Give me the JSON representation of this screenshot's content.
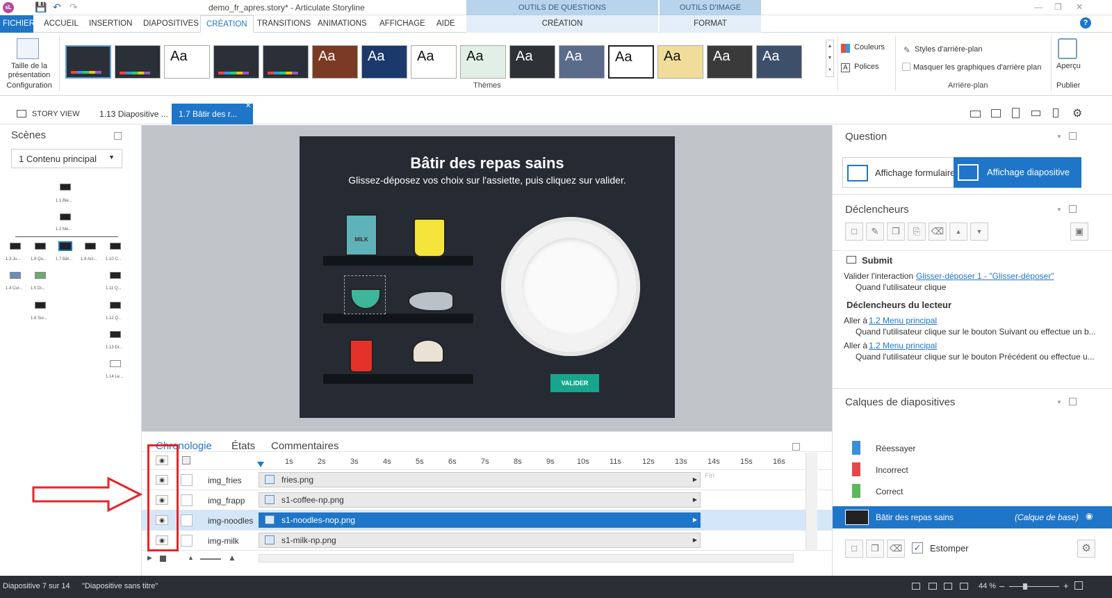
{
  "app": {
    "title": "demo_fr_apres.story* - Articulate Storyline",
    "logo": "sL"
  },
  "context_headers": [
    "OUTILS DE QUESTIONS",
    "OUTILS D'IMAGE"
  ],
  "ribbon_tabs": [
    "FICHIER",
    "ACCUEIL",
    "INSERTION",
    "DIAPOSITIVES",
    "CRÉATION",
    "TRANSITIONS",
    "ANIMATIONS",
    "AFFICHAGE",
    "AIDE"
  ],
  "context_tabs": [
    "CRÉATION",
    "FORMAT"
  ],
  "ribbon": {
    "config_label": "Taille de la présentation",
    "config_group": "Configuration",
    "theme_text": "Aa",
    "themes_group": "Thèmes",
    "colors": "Couleurs",
    "fonts": "Polices",
    "bg_styles": "Styles d'arrière-plan",
    "hide_bg": "Masquer les graphiques d'arrière plan",
    "bg_group": "Arrière-plan",
    "preview": "Aperçu",
    "publish": "Publier"
  },
  "doc_tabs": {
    "story": "STORY VIEW",
    "tab1": "1.13 Diapositive ...",
    "tab2": "1.7 Bâtir des r..."
  },
  "scenes": {
    "title": "Scènes",
    "dropdown": "1 Contenu principal",
    "thumbs": [
      "1.1 Bie...",
      "1.2 Me...",
      "1.3 Ju...",
      "1.8 Qu...",
      "1.7 Bât...",
      "1.9 Act...",
      "1.10 C...",
      "1.4 Cur...",
      "1.5 Di...",
      "1.11 Q...",
      "1.6 Sui...",
      "1.12 Q...",
      "1.13 Di...",
      "1.14 Le..."
    ]
  },
  "slide": {
    "title": "Bâtir des repas sains",
    "subtitle": "Glissez-déposez vos choix sur l'assiette, puis cliquez sur valider.",
    "button": "VALIDER",
    "milk": "MILK"
  },
  "timeline": {
    "tabs": [
      "Chronologie",
      "États",
      "Commentaires"
    ],
    "ticks": [
      "1s",
      "2s",
      "3s",
      "4s",
      "5s",
      "6s",
      "7s",
      "8s",
      "9s",
      "10s",
      "11s",
      "12s",
      "13s",
      "14s",
      "15s",
      "16s"
    ],
    "end_label": "Fin",
    "rows": [
      {
        "name": "img_fries",
        "file": "fries.png"
      },
      {
        "name": "img_frapp",
        "file": "s1-coffee-np.png"
      },
      {
        "name": "img-noodles",
        "file": "s1-noodles-nop.png"
      },
      {
        "name": "img-milk",
        "file": "s1-milk-np.png"
      }
    ]
  },
  "right": {
    "question_title": "Question",
    "form_view": "Affichage formulaire",
    "slide_view": "Affichage diapositive",
    "triggers_title": "Déclencheurs",
    "submit": "Submit",
    "validate": "Valider l'interaction",
    "validate_link": "Glisser-déposer 1 - \"Glisser-déposer\"",
    "when_click": "Quand l'utilisateur clique",
    "player_triggers": "Déclencheurs du lecteur",
    "goto": "Aller à",
    "goto_link": "1.2 Menu principal",
    "next_cond": "Quand l'utilisateur clique sur le bouton Suivant ou effectue un b...",
    "prev_cond": "Quand l'utilisateur clique sur le bouton Précédent ou effectue u...",
    "layers_title": "Calques de diapositives",
    "layers": [
      {
        "name": "Réessayer",
        "color": "#3a8fd9"
      },
      {
        "name": "Incorrect",
        "color": "#e8454f"
      },
      {
        "name": "Correct",
        "color": "#5cb85c"
      }
    ],
    "base_layer": "Bâtir des repas sains",
    "base_tag": "(Calque de base)",
    "fade": "Estomper"
  },
  "status": {
    "slide": "Diapositive 7 sur 14",
    "name": "\"Diapositive sans titre\"",
    "zoom": "44 %"
  }
}
